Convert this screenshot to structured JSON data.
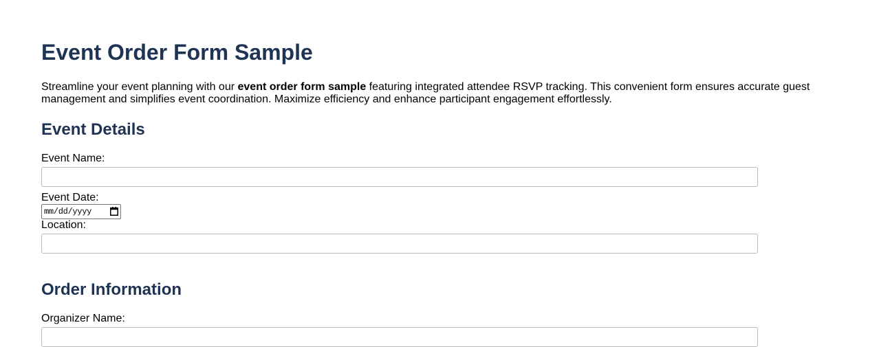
{
  "page": {
    "title": "Event Order Form Sample",
    "intro": {
      "before": "Streamline your event planning with our ",
      "bold": "event order form sample",
      "after": " featuring integrated attendee RSVP tracking. This convenient form ensures accurate guest management and simplifies event coordination. Maximize efficiency and enhance participant engagement effortlessly."
    }
  },
  "event_details": {
    "heading": "Event Details",
    "event_name_label": "Event Name:",
    "event_name_value": "",
    "event_date_label": "Event Date:",
    "event_date_placeholder": "mm/dd/yyyy",
    "location_label": "Location:",
    "location_value": ""
  },
  "order_information": {
    "heading": "Order Information",
    "organizer_name_label": "Organizer Name:",
    "organizer_name_value": ""
  },
  "colors": {
    "heading": "#1f3354",
    "text": "#000000",
    "input_border": "#b9b9b9"
  },
  "icons": {
    "date_picker": "calendar-icon"
  }
}
